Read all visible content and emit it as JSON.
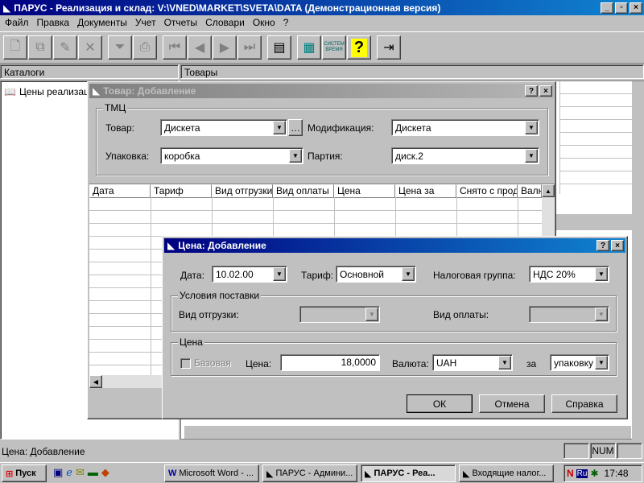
{
  "window": {
    "title": "ПАРУС - Реализация и склад: V:\\VNED\\MARKET\\SVETA\\DATA (Демонстрационная версия)",
    "controls": [
      "_",
      "▫",
      "×"
    ]
  },
  "menu": [
    {
      "label": "Файл"
    },
    {
      "label": "Правка"
    },
    {
      "label": "Документы"
    },
    {
      "label": "Учет"
    },
    {
      "label": "Отчеты"
    },
    {
      "label": "Словари"
    },
    {
      "label": "Окно"
    },
    {
      "label": "?"
    }
  ],
  "toolbar": {
    "icons": [
      "new-icon",
      "copy-icon",
      "edit-icon",
      "delete-icon",
      "filter-icon",
      "print-icon",
      "first-icon",
      "prev-icon",
      "next-icon",
      "last-icon",
      "list-icon",
      "calculator-icon",
      "system-icon",
      "help-icon",
      "exit-icon"
    ],
    "system_label": "СИСТЕМ ВРЕМЯ"
  },
  "panes": {
    "left_header": "Каталоги",
    "right_header": "Товары",
    "tree_item": "Цены реализации"
  },
  "goods_dialog": {
    "title": "Товар: Добавление",
    "group_title": "ТМЦ",
    "tovar_label": "Товар:",
    "tovar_value": "Дискета",
    "mod_label": "Модификация:",
    "mod_value": "Дискета",
    "pack_label": "Упаковка:",
    "pack_value": "коробка",
    "batch_label": "Партия:",
    "batch_value": "диск.2",
    "columns": [
      "Дата",
      "Тариф",
      "Вид отгрузки",
      "Вид оплаты",
      "Цена",
      "Цена за",
      "Снято с прода",
      "Валю"
    ]
  },
  "price_dialog": {
    "title": "Цена: Добавление",
    "date_label": "Дата:",
    "date_value": "10.02.00",
    "tariff_label": "Тариф:",
    "tariff_value": "Основной",
    "tax_label": "Налоговая группа:",
    "tax_value": "НДС 20%",
    "delivery_group": "Условия поставки",
    "shipment_label": "Вид отгрузки:",
    "payment_label": "Вид оплаты:",
    "price_group": "Цена",
    "base_label": "Базовая",
    "price_label": "Цена:",
    "price_value": "18,0000",
    "currency_label": "Валюта:",
    "currency_value": "UAH",
    "per_label": "за",
    "per_value": "упаковку",
    "ok_label": "ОК",
    "cancel_label": "Отмена",
    "help_label": "Справка"
  },
  "status": {
    "text": "Цена: Добавление",
    "num": "NUM"
  },
  "taskbar": {
    "start_label": "Пуск",
    "tasks": [
      {
        "label": "Microsoft Word - ..."
      },
      {
        "label": "ПАРУС - Админи..."
      },
      {
        "label": "ПАРУС - Реа..."
      },
      {
        "label": "Входящие налог..."
      }
    ],
    "lang": "Ru",
    "clock": "17:48"
  }
}
